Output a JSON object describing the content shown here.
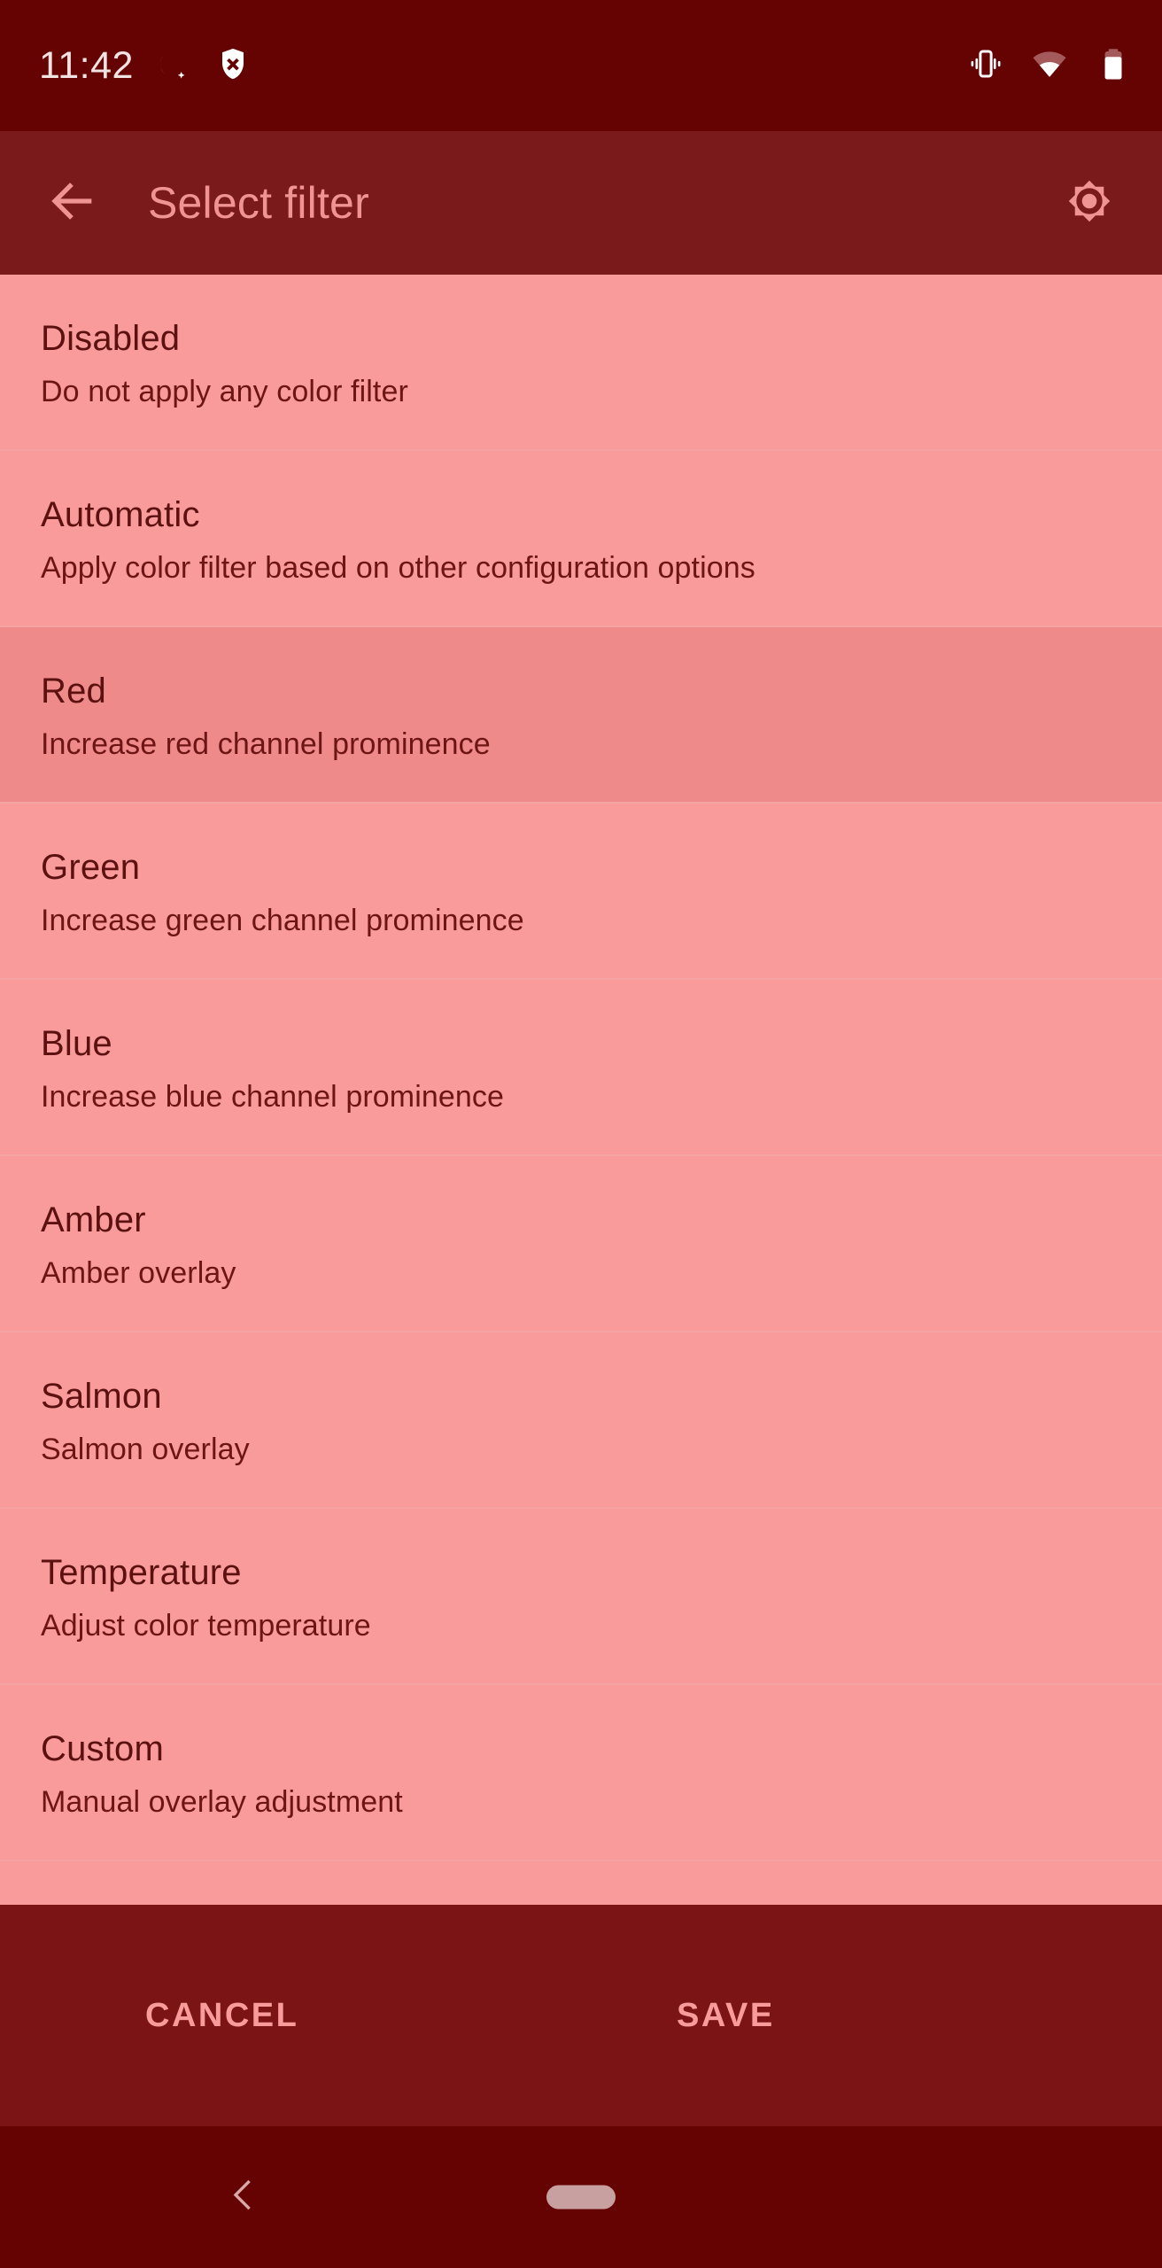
{
  "status_bar": {
    "time": "11:42",
    "icons": [
      {
        "name": "do-not-disturb-moon-icon"
      },
      {
        "name": "shield-x-icon"
      },
      {
        "name": "vibrate-icon"
      },
      {
        "name": "wifi-icon"
      },
      {
        "name": "battery-icon"
      }
    ]
  },
  "app_bar": {
    "back_icon": "arrow-left-icon",
    "title": "Select filter",
    "action_icon": "brightness-icon"
  },
  "filters": [
    {
      "title": "Disabled",
      "subtitle": "Do not apply any color filter",
      "selected": false
    },
    {
      "title": "Automatic",
      "subtitle": "Apply color filter based on other configuration options",
      "selected": false
    },
    {
      "title": "Red",
      "subtitle": "Increase red channel prominence",
      "selected": true
    },
    {
      "title": "Green",
      "subtitle": "Increase green channel prominence",
      "selected": false
    },
    {
      "title": "Blue",
      "subtitle": "Increase blue channel prominence",
      "selected": false
    },
    {
      "title": "Amber",
      "subtitle": "Amber overlay",
      "selected": false
    },
    {
      "title": "Salmon",
      "subtitle": "Salmon overlay",
      "selected": false
    },
    {
      "title": "Temperature",
      "subtitle": "Adjust color temperature",
      "selected": false
    },
    {
      "title": "Custom",
      "subtitle": "Manual overlay adjustment",
      "selected": false
    }
  ],
  "action_bar": {
    "cancel_label": "CANCEL",
    "save_label": "SAVE"
  },
  "nav_bar": {
    "back_icon": "chevron-left-icon",
    "home_indicator": "home-pill-indicator"
  },
  "colors": {
    "status_bar_bg": "#650303",
    "app_bar_bg": "#7b1a1a",
    "list_bg": "#fa9b9b",
    "selected_row_bg": "#ee8a8a",
    "action_bar_bg": "#7b1515",
    "nav_bar_bg": "#650303",
    "title_text": "#f09393",
    "row_title_text": "#5c1111",
    "row_sub_text": "#6d1515",
    "action_text": "#fa9b9b",
    "divider": "#f5a3a3"
  }
}
